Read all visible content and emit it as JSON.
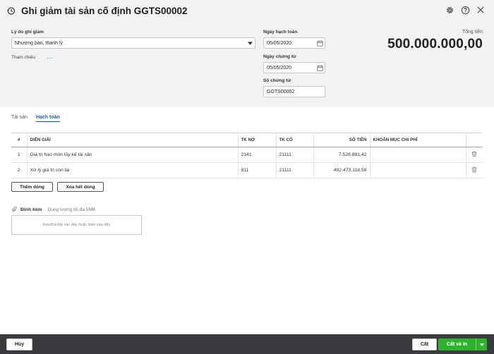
{
  "header": {
    "title": "Ghi giảm tài sản cố định GGTS00002",
    "icons": {
      "history": "history-icon",
      "settings": "gear-icon",
      "help": "help-icon",
      "close": "close-icon"
    }
  },
  "form": {
    "reason_label": "Lý do ghi giảm",
    "reason_value": "Nhượng bán, thanh lý",
    "reference_label": "Tham chiếu",
    "reference_more": "...",
    "posting_date_label": "Ngày hạch toán",
    "posting_date_value": "05/05/2020",
    "voucher_date_label": "Ngày chứng từ",
    "voucher_date_value": "05/05/2020",
    "voucher_no_label": "Số chứng từ",
    "voucher_no_value": "GGTS00002",
    "total_label": "Tổng tiền",
    "total_value": "500.000.000,00"
  },
  "tabs": [
    {
      "label": "Tài sản",
      "active": false
    },
    {
      "label": "Hạch toán",
      "active": true
    }
  ],
  "table": {
    "headers": [
      "#",
      "DIỄN GIẢI",
      "TK NỢ",
      "TK CÓ",
      "SỐ TIỀN",
      "KHOẢN MỤC CHI PHÍ"
    ],
    "rows": [
      {
        "no": "1",
        "desc": "Giá trị hao mòn lũy kế tài sản",
        "debit": "2141",
        "credit": "21111",
        "amount": "7.526.881,42",
        "cost_item": ""
      },
      {
        "no": "2",
        "desc": "Xử lý giá trị còn lại",
        "debit": "811",
        "credit": "21111",
        "amount": "492.473.118,58",
        "cost_item": ""
      }
    ],
    "add_row_label": "Thêm dòng",
    "clear_rows_label": "Xóa hết dòng"
  },
  "attachment": {
    "title": "Đính kèm",
    "limit": "Dung lượng tối đa 5MB",
    "dropzone_text": "Kéo/thả tệp vào đây hoặc bấm vào đây"
  },
  "footer": {
    "cancel_label": "Hủy",
    "save_label": "Cất",
    "save_print_label": "Cất và In"
  },
  "colors": {
    "header_bg": "#f1f2f4",
    "accent": "#1a56c4",
    "primary_button": "#2fb32c",
    "footer_bg": "#3a3b3e"
  }
}
